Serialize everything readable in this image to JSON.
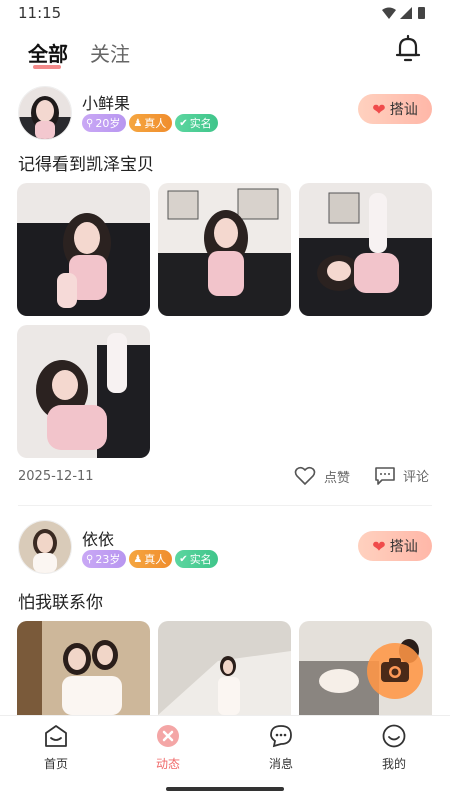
{
  "status": {
    "time": "11:15"
  },
  "tabs": [
    {
      "label": "全部"
    },
    {
      "label": "关注"
    }
  ],
  "posts": [
    {
      "username": "小鲜果",
      "age_badge": "20岁",
      "real_badge": "真人",
      "verified_badge": "实名",
      "greet_label": "搭讪",
      "text": "记得看到凯泽宝贝",
      "date": "2025-12-11",
      "like_label": "点赞",
      "comment_label": "评论"
    },
    {
      "username": "依依",
      "age_badge": "23岁",
      "real_badge": "真人",
      "verified_badge": "实名",
      "greet_label": "搭讪",
      "text": "怕我联系你"
    }
  ],
  "bottom_nav": [
    {
      "label": "首页",
      "icon": "home-icon"
    },
    {
      "label": "动态",
      "icon": "moments-icon",
      "active": true
    },
    {
      "label": "消息",
      "icon": "message-icon"
    },
    {
      "label": "我的",
      "icon": "profile-icon"
    }
  ],
  "colors": {
    "accent": "#f06a6a",
    "greet_bg": "#ffc4b3",
    "heart": "#f04b4b"
  }
}
